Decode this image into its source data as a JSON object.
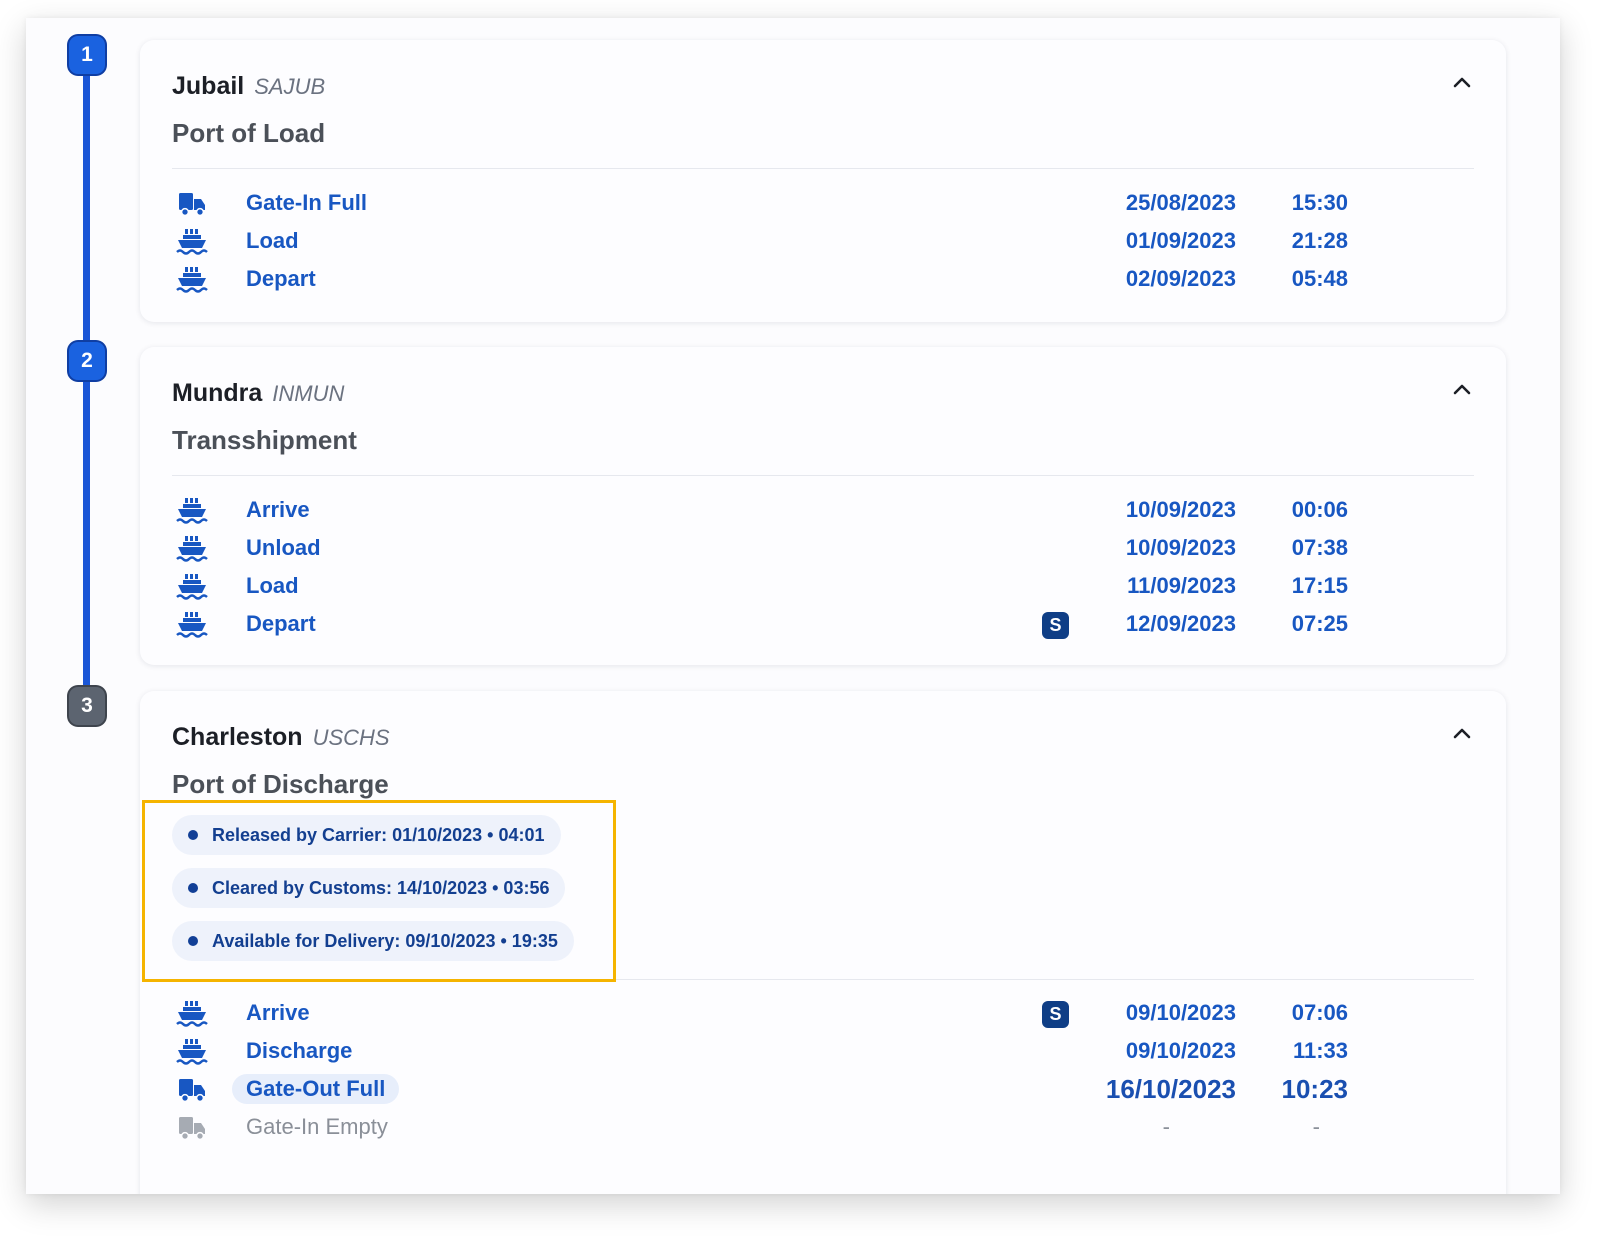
{
  "steps": [
    {
      "number": "1",
      "city": "Jubail",
      "code": "SAJUB",
      "role": "Port of Load",
      "events": [
        {
          "icon": "truck-icon",
          "name": "Gate-In Full",
          "date": "25/08/2023",
          "time": "15:30"
        },
        {
          "icon": "ship-icon",
          "name": "Load",
          "date": "01/09/2023",
          "time": "21:28"
        },
        {
          "icon": "ship-icon",
          "name": "Depart",
          "date": "02/09/2023",
          "time": "05:48"
        }
      ]
    },
    {
      "number": "2",
      "city": "Mundra",
      "code": "INMUN",
      "role": "Transshipment",
      "events": [
        {
          "icon": "ship-icon",
          "name": "Arrive",
          "date": "10/09/2023",
          "time": "00:06"
        },
        {
          "icon": "ship-icon",
          "name": "Unload",
          "date": "10/09/2023",
          "time": "07:38"
        },
        {
          "icon": "ship-icon",
          "name": "Load",
          "date": "11/09/2023",
          "time": "17:15"
        },
        {
          "icon": "ship-icon",
          "name": "Depart",
          "date": "12/09/2023",
          "time": "07:25",
          "badge": "S"
        }
      ]
    },
    {
      "number": "3",
      "city": "Charleston",
      "code": "USCHS",
      "role": "Port of Discharge",
      "statuses": [
        "Released by Carrier: 01/10/2023 • 04:01",
        "Cleared by Customs: 14/10/2023 • 03:56",
        "Available for Delivery: 09/10/2023 • 19:35"
      ],
      "events": [
        {
          "icon": "ship-icon",
          "name": "Arrive",
          "date": "09/10/2023",
          "time": "07:06",
          "badge": "S"
        },
        {
          "icon": "ship-icon",
          "name": "Discharge",
          "date": "09/10/2023",
          "time": "11:33"
        },
        {
          "icon": "truck-icon",
          "name": "Gate-Out Full",
          "date": "16/10/2023",
          "time": "10:23",
          "state": "current"
        },
        {
          "icon": "truck-icon",
          "name": "Gate-In Empty",
          "date": "-",
          "time": "-",
          "state": "pending"
        }
      ]
    }
  ],
  "colors": {
    "accent": "#1857c2",
    "timeline": "#1a56d6",
    "highlight": "#f5b400",
    "pending": "#8a8f98"
  }
}
